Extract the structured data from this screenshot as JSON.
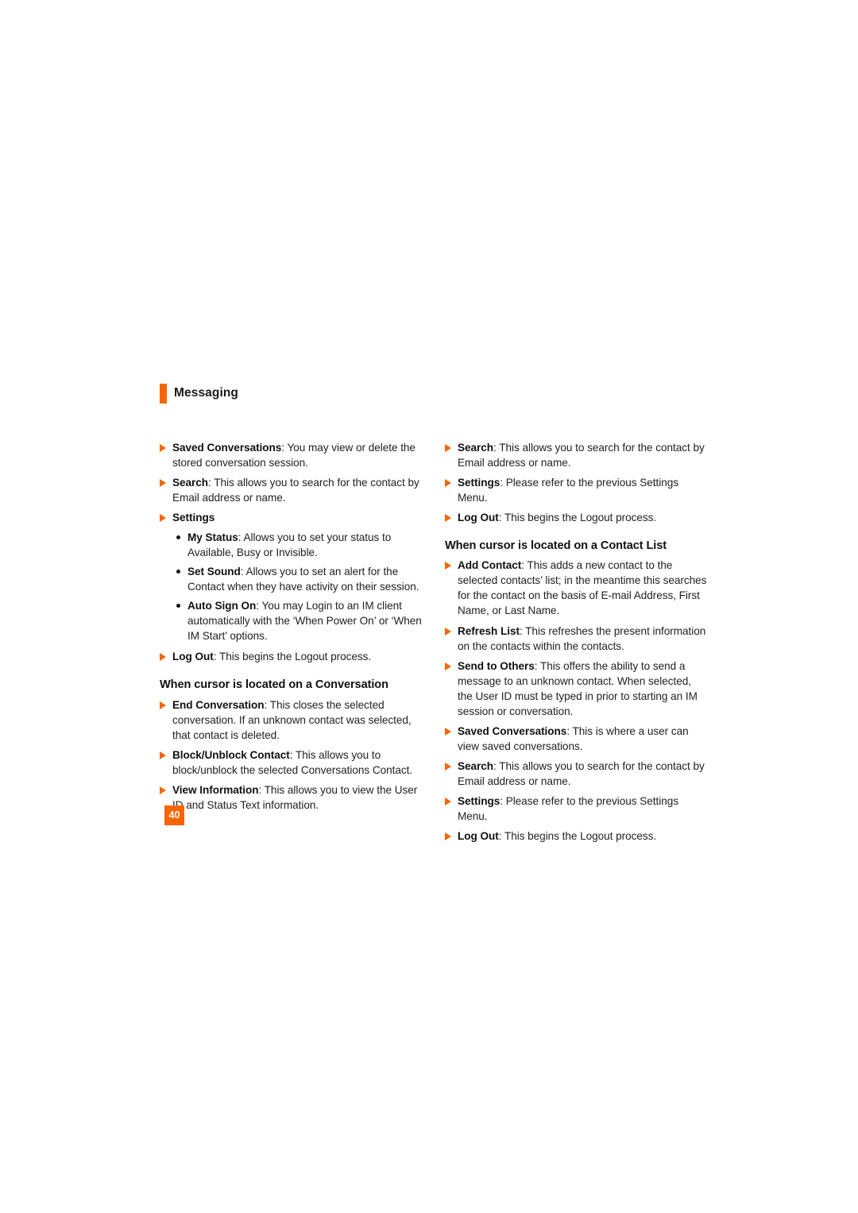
{
  "document": {
    "running_header": "Messaging",
    "page_number": "40",
    "accent_color": "#f96400"
  },
  "left_column": {
    "items": [
      {
        "id": "saved-conversations",
        "term": "Saved Conversations",
        "desc": ": You may view or delete the stored conversation session."
      },
      {
        "id": "search",
        "term": "Search",
        "desc": ": This allows you to search for the contact by Email address or name."
      },
      {
        "id": "settings",
        "term": "Settings",
        "desc": ""
      }
    ],
    "settings_sub_items": [
      {
        "id": "my-status",
        "term": "My Status",
        "desc": ": Allows you to set your status to Available, Busy or Invisible."
      },
      {
        "id": "set-sound",
        "term": "Set Sound",
        "desc": ": Allows you to set an alert for the Contact when they have activity on their session."
      },
      {
        "id": "auto-sign-on",
        "term": "Auto Sign On",
        "desc": ": You may Login to an IM client automatically with the ‘When Power On’ or ‘When IM Start’ options."
      }
    ],
    "log_out": {
      "id": "log-out",
      "term": "Log Out",
      "desc": ": This begins the Logout process."
    },
    "conversation_heading": "When cursor is located on a Conversation",
    "conversation_items": [
      {
        "id": "end-conversation",
        "term": "End Conversation",
        "desc": ": This closes the selected conversation. If an unknown contact was selected, that contact is deleted."
      },
      {
        "id": "block-unblock-contact",
        "term": "Block/Unblock Contact",
        "desc": ": This allows you to block/unblock the selected Conversations Contact."
      },
      {
        "id": "view-information",
        "term": "View Information",
        "desc": ": This allows you to view the User ID and Status Text information."
      }
    ]
  },
  "right_column": {
    "top_items": [
      {
        "id": "search",
        "term": "Search",
        "desc": ": This allows you to search for the contact by Email address or name."
      },
      {
        "id": "settings",
        "term": "Settings",
        "desc": ": Please refer to the previous Settings Menu."
      },
      {
        "id": "log-out",
        "term": "Log Out",
        "desc": ": This begins the Logout process."
      }
    ],
    "contact_list_heading": "When cursor is located on a Contact List",
    "contact_list_items": [
      {
        "id": "add-contact",
        "term": "Add Contact",
        "desc": ": This adds a new contact to the selected contacts’ list; in the meantime this searches for the contact on the basis of E-mail Address, First Name, or Last Name."
      },
      {
        "id": "refresh-list",
        "term": "Refresh List",
        "desc": ": This refreshes the present information on the contacts within the contacts."
      },
      {
        "id": "send-to-others",
        "term": "Send to Others",
        "desc": ": This offers the ability to send a message to an unknown contact. When selected, the User ID must be typed in prior to starting an IM session or conversation."
      },
      {
        "id": "saved-conversations",
        "term": "Saved Conversations",
        "desc": ": This is where a user can view saved conversations."
      },
      {
        "id": "search-2",
        "term": "Search",
        "desc": ": This allows you to search for the contact by Email address or name."
      },
      {
        "id": "settings-2",
        "term": "Settings",
        "desc": ": Please refer to the previous Settings Menu."
      },
      {
        "id": "log-out-2",
        "term": "Log Out",
        "desc": ": This begins the Logout process."
      }
    ]
  }
}
